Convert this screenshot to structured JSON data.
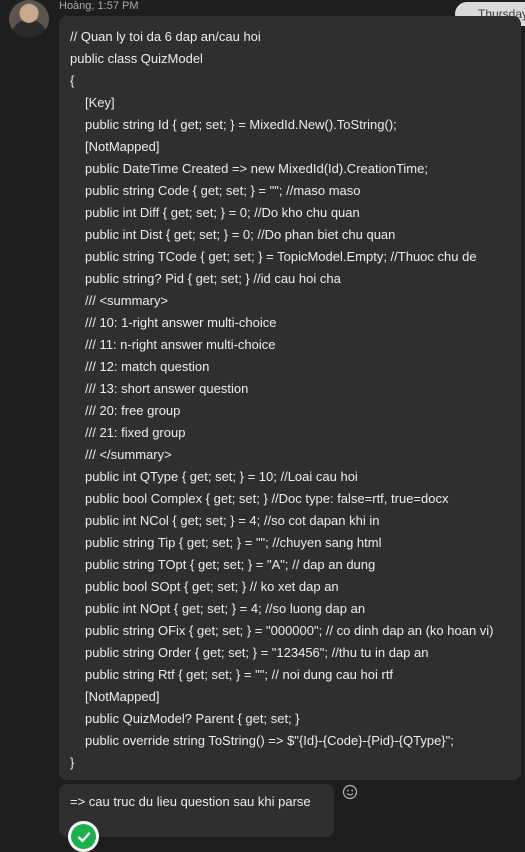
{
  "chat": {
    "sender": "Hoàng, 1:57 PM",
    "date_label": "Thursday",
    "code_lines": [
      {
        "text": "// Quan ly toi da 6 dap an/cau hoi",
        "indent": false
      },
      {
        "text": "public class QuizModel",
        "indent": false
      },
      {
        "text": "{",
        "indent": false
      },
      {
        "text": "[Key]",
        "indent": true
      },
      {
        "text": "public string Id { get; set; } = MixedId.New().ToString();",
        "indent": true
      },
      {
        "text": "[NotMapped]",
        "indent": true
      },
      {
        "text": "public DateTime Created => new MixedId(Id).CreationTime;",
        "indent": true
      },
      {
        "text": "public string Code { get; set; } = \"\"; //maso maso",
        "indent": true
      },
      {
        "text": "public int Diff { get; set; } = 0; //Do kho chu quan",
        "indent": true
      },
      {
        "text": "public int Dist { get; set; } = 0; //Do phan biet chu quan",
        "indent": true
      },
      {
        "text": "public string TCode { get; set; } = TopicModel.Empty; //Thuoc chu de",
        "indent": true
      },
      {
        "text": "public string? Pid { get; set; } //id cau hoi cha",
        "indent": true
      },
      {
        "text": "/// <summary>",
        "indent": true
      },
      {
        "text": "/// 10: 1-right answer multi-choice",
        "indent": true
      },
      {
        "text": "/// 11: n-right answer multi-choice",
        "indent": true
      },
      {
        "text": "/// 12: match question",
        "indent": true
      },
      {
        "text": "/// 13: short answer question",
        "indent": true
      },
      {
        "text": "/// 20: free group",
        "indent": true
      },
      {
        "text": "/// 21: fixed group",
        "indent": true
      },
      {
        "text": "/// </summary>",
        "indent": true
      },
      {
        "text": "public int QType { get; set; } = 10; //Loai cau hoi",
        "indent": true
      },
      {
        "text": "public bool Complex { get; set; } //Doc type: false=rtf, true=docx",
        "indent": true
      },
      {
        "text": "public int NCol { get; set; } = 4; //so cot dapan khi in",
        "indent": true
      },
      {
        "text": "public string Tip { get; set; } = \"\"; //chuyen sang html",
        "indent": true
      },
      {
        "text": "public string TOpt { get; set; } = \"A\"; // dap an dung",
        "indent": true
      },
      {
        "text": "public bool SOpt { get; set; } // ko xet dap an",
        "indent": true
      },
      {
        "text": "public int NOpt { get; set; } = 4; //so luong dap an",
        "indent": true
      },
      {
        "text": "public string OFix { get; set; } = \"000000\"; // co dinh dap an (ko hoan vi)",
        "indent": true
      },
      {
        "text": "public string Order { get; set; } = \"123456\"; //thu tu in dap an",
        "indent": true
      },
      {
        "text": "public string Rtf { get; set; } = \"\"; // noi dung cau hoi rtf",
        "indent": true
      },
      {
        "text": "[NotMapped]",
        "indent": true
      },
      {
        "text": "public QuizModel? Parent { get; set; }",
        "indent": true
      },
      {
        "text": "public override string ToString() => $\"{Id}-{Code}-{Pid}-{QType}\";",
        "indent": true
      },
      {
        "text": "}",
        "indent": false
      }
    ],
    "message2": "=> cau truc du lieu question sau khi parse",
    "icons": {
      "reaction": "smiley-icon",
      "status": "check-circle-icon"
    },
    "colors": {
      "bubble": "#2f2f2f",
      "background": "#1e1e1e",
      "check": "#18b24a"
    }
  }
}
